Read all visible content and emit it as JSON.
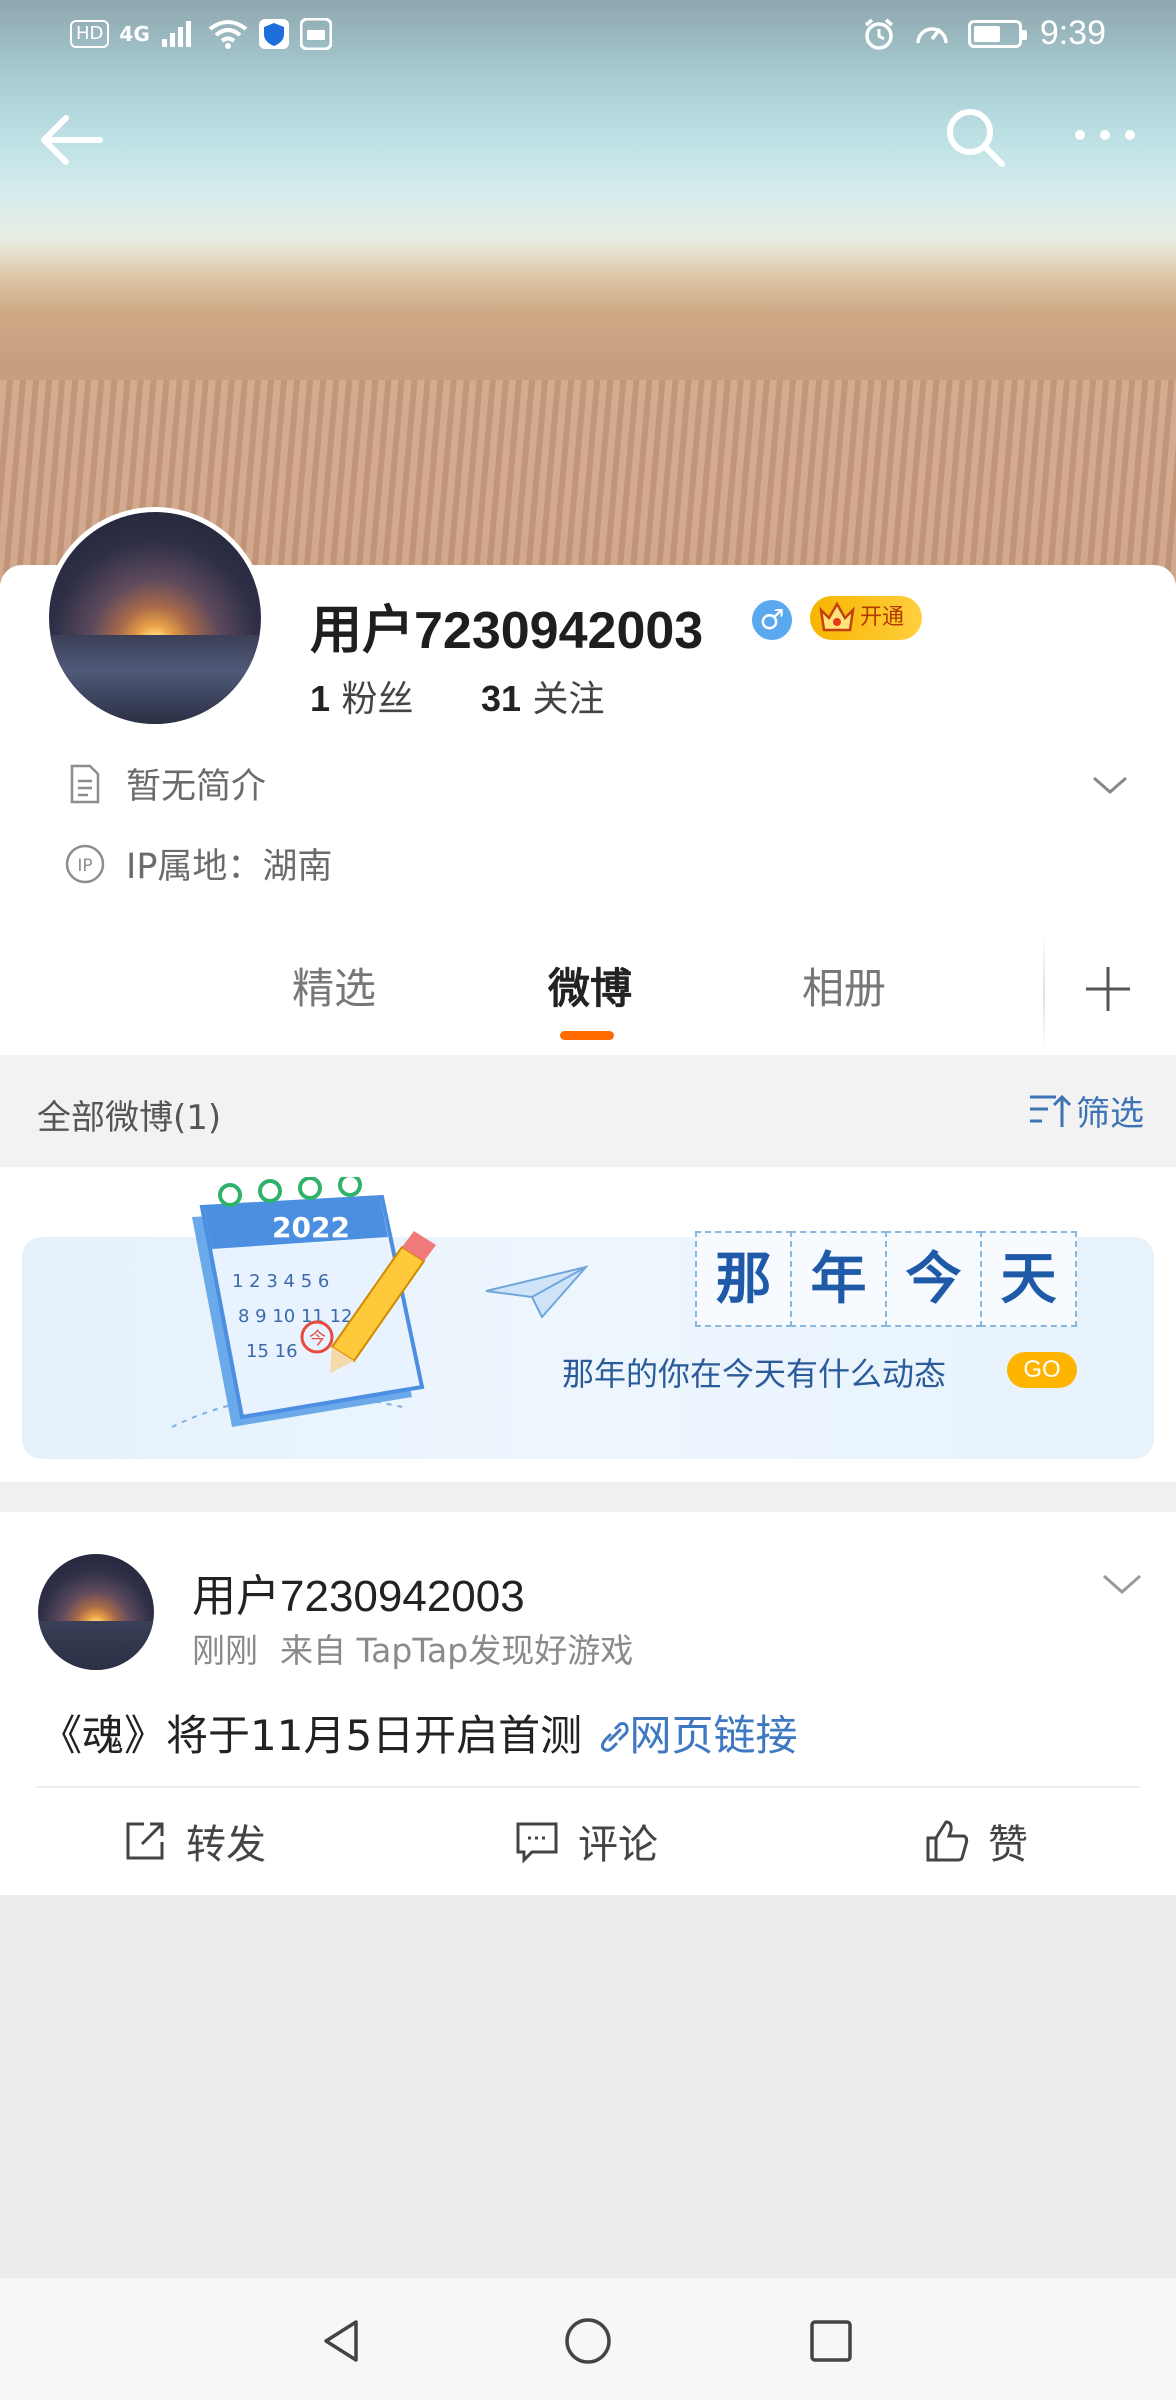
{
  "status_bar": {
    "left_chips": [
      "HD",
      "4G"
    ],
    "time": "9:39"
  },
  "profile": {
    "username": "用户7230942003",
    "gender_symbol": "♂",
    "vip_label": "开通",
    "fans_count": "1",
    "fans_label": "粉丝",
    "following_count": "31",
    "following_label": "关注",
    "bio": "暂无简介",
    "ip_location": "IP属地：湖南"
  },
  "tabs": [
    {
      "label": "精选"
    },
    {
      "label": "微博"
    },
    {
      "label": "相册"
    }
  ],
  "filter": {
    "left_label": "全部微博(1)",
    "right_label": "筛选"
  },
  "memory_banner": {
    "title_chars": [
      "那",
      "年",
      "今",
      "天"
    ],
    "subtitle": "那年的你在今天有什么动态",
    "go_label": "GO",
    "calendar_year": "2022",
    "calendar_marked_day": "今"
  },
  "post": {
    "username": "用户7230942003",
    "time": "刚刚",
    "source": "来自 TapTap发现好游戏",
    "text": "《魂》将于11月5日开启首测 ",
    "link_label": "网页链接",
    "actions": {
      "repost": "转发",
      "comment": "评论",
      "like": "赞"
    }
  },
  "colors": {
    "accent_orange": "#ff6a00",
    "link_blue": "#3f78c2",
    "vip_gold": "#f7b500"
  }
}
